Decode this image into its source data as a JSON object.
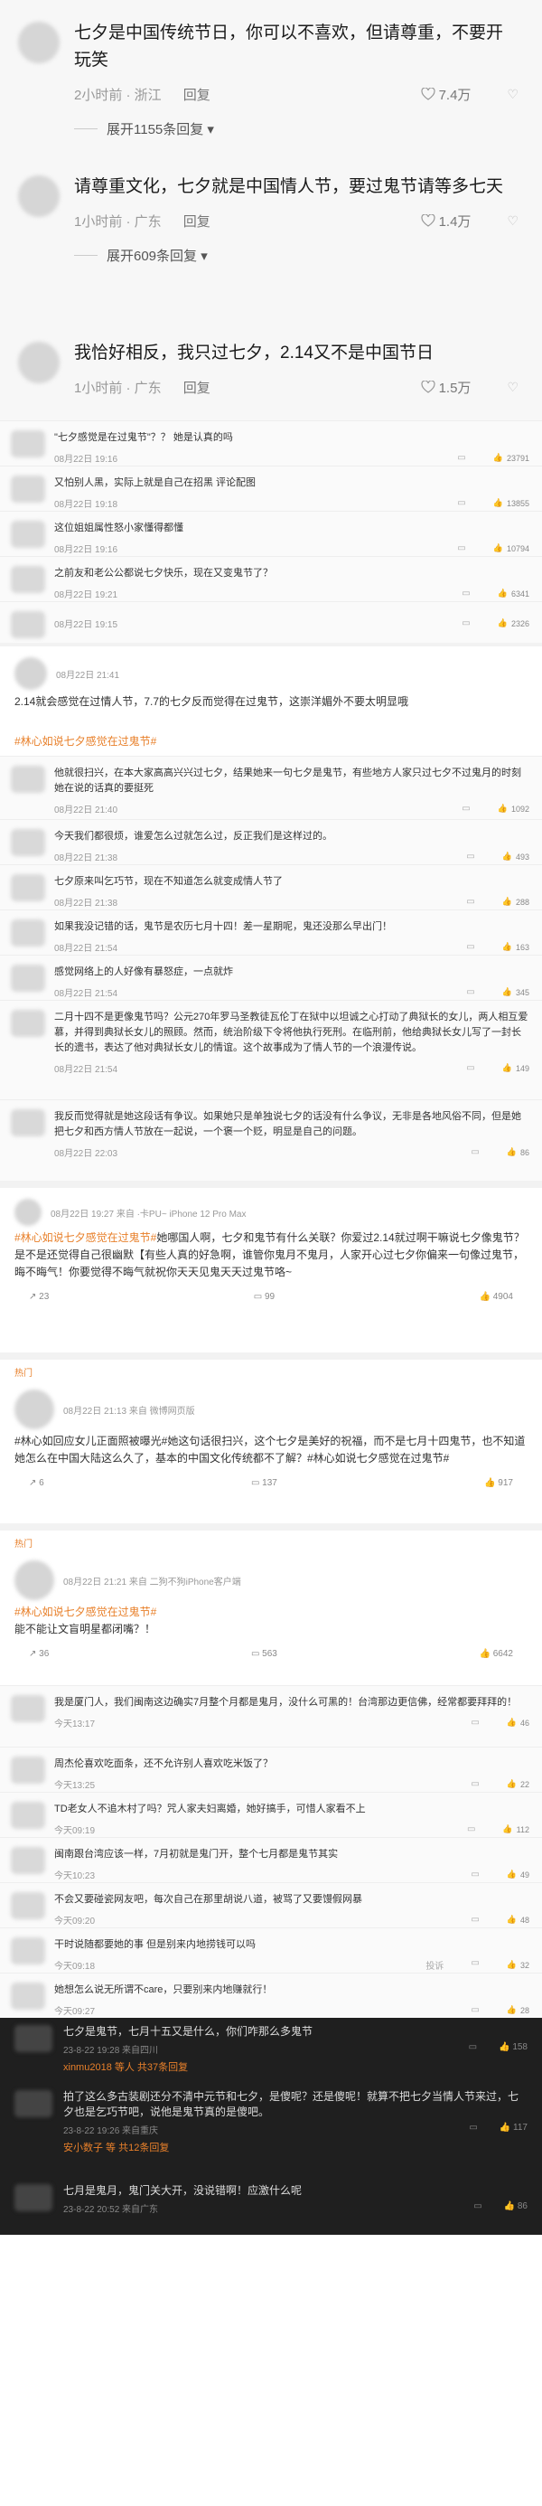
{
  "top_comments": [
    {
      "text": "七夕是中国传统节日，你可以不喜欢，但请尊重，不要开玩笑",
      "time": "2小时前 · 浙江",
      "reply": "回复",
      "likes": "7.4万",
      "expand": "展开1155条回复"
    },
    {
      "text": "请尊重文化，七夕就是中国情人节，要过鬼节请等多七天",
      "time": "1小时前 · 广东",
      "reply": "回复",
      "likes": "1.4万",
      "expand": "展开609条回复"
    },
    {
      "text": "我恰好相反，我只过七夕，2.14又不是中国节日",
      "time": "1小时前 · 广东",
      "reply": "回复",
      "likes": "1.5万",
      "expand": ""
    }
  ],
  "small_comments": [
    {
      "text": "\"七夕感觉是在过鬼节\"？？ 她是认真的吗",
      "date": "08月22日 19:16",
      "likes": "23791"
    },
    {
      "text": "又怕别人黑，实际上就是自己在招黑 评论配图",
      "date": "08月22日 19:18",
      "likes": "13855"
    },
    {
      "text": "这位姐姐属性怒小家懂得都懂",
      "date": "08月22日 19:16",
      "likes": "10794"
    },
    {
      "text": "之前友和老公公都说七夕快乐，现在又变鬼节了？",
      "date": "08月22日 19:21",
      "likes": "6341"
    },
    {
      "text": "",
      "date": "08月22日 19:15",
      "likes": "2326"
    }
  ],
  "post1": {
    "date": "08月22日 21:41",
    "text": "2.14就会感觉在过情人节，7.7的七夕反而觉得在过鬼节，这崇洋媚外不要太明显哦",
    "topic": "#林心如说七夕感觉在过鬼节#"
  },
  "replies": [
    {
      "text": "他就很扫兴，在本大家高高兴兴过七夕，结果她来一句七夕是鬼节，有些地方人家只过七夕不过鬼月的时刻她在说的话真的要挺死",
      "date": "08月22日 21:40",
      "likes": "1092"
    },
    {
      "text": "今天我们都很烦，谁爱怎么过就怎么过，反正我们是这样过的。",
      "date": "08月22日 21:38",
      "likes": "493"
    },
    {
      "text": "七夕原来叫乞巧节，现在不知道怎么就变成情人节了",
      "date": "08月22日 21:38",
      "likes": "288"
    },
    {
      "text": "如果我没记错的话，鬼节是农历七月十四！差一星期呢，鬼还没那么早出门！",
      "date": "08月22日 21:54",
      "likes": "163"
    },
    {
      "text": "感觉网络上的人好像有暴怒症，一点就炸",
      "date": "08月22日 21:54",
      "likes": "345"
    },
    {
      "text": "二月十四不是更像鬼节吗？公元270年罗马圣教徒瓦伦丁在狱中以坦诚之心打动了典狱长的女儿，两人相互爱慕，并得到典狱长女儿的照顾。然而，统治阶级下令将他执行死刑。在临刑前，他给典狱长女儿写了一封长长的遗书，表达了他对典狱长女儿的情谊。这个故事成为了情人节的一个浪漫传说。",
      "date": "08月22日 21:54",
      "likes": "149"
    },
    {
      "text": "我反而觉得就是她这段话有争议。如果她只是单独说七夕的话没有什么争议，无非是各地风俗不同，但是她把七夕和西方情人节放在一起说，一个褒一个贬，明显是自己的问题。",
      "date": "08月22日 22:03",
      "likes": "86"
    }
  ],
  "post2": {
    "date": "08月22日 19:27  来自 ·卡PU~ iPhone 12 Pro Max",
    "topic": "#林心如说七夕感觉在过鬼节#",
    "text": "她哪国人啊，七夕和鬼节有什么关联？你爱过2.14就过啊干嘛说七夕像鬼节？是不是还觉得自己很幽默【有些人真的好急啊，谁管你鬼月不鬼月，人家开心过七夕你偏来一句像过鬼节，晦不晦气！你要觉得不晦气就祝你天天见鬼天天过鬼节咯~",
    "repost": "23",
    "comments": "99",
    "likes": "4904"
  },
  "hot_label": "热门",
  "post3": {
    "date": "08月22日 21:13  来自 微博网页版",
    "text": "#林心如回应女儿正面照被曝光#她这句话很扫兴，这个七夕是美好的祝福，而不是七月十四鬼节，也不知道她怎么在中国大陆这么久了，基本的中国文化传统都不了解？#林心如说七夕感觉在过鬼节#",
    "repost": "6",
    "comments": "137",
    "likes": "917"
  },
  "post4": {
    "date": "08月22日 21:21  来自 二狗不狗iPhone客户端",
    "topic": "#林心如说七夕感觉在过鬼节#",
    "text": "能不能让文盲明星都闭嘴？！",
    "repost": "36",
    "comments": "563",
    "likes": "6642"
  },
  "replies2": [
    {
      "text": "我是厦门人，我们闽南这边确实7月整个月都是鬼月，没什么可黑的！台湾那边更信佛，经常都要拜拜的！",
      "date": "今天13:17",
      "likes": "46"
    },
    {
      "text": "周杰伦喜欢吃面条，还不允许别人喜欢吃米饭了？",
      "date": "今天13:25",
      "likes": "22"
    },
    {
      "text": "TD老女人不追木村了吗？咒人家夫妇离婚，她好搞手，可惜人家看不上",
      "date": "今天09:19",
      "likes": "112"
    },
    {
      "text": "闽南跟台湾应该一样，7月初就是鬼门开，整个七月都是鬼节其实",
      "date": "今天10:23",
      "likes": "49"
    },
    {
      "text": "不会又要碰瓷网友吧，每次自己在那里胡说八道，被骂了又要馒假网暴",
      "date": "今天09:20",
      "likes": "48"
    },
    {
      "text": "干时说随都要她的事 但是别来内地捞钱可以吗",
      "date": "今天09:18",
      "likes": "32",
      "extra": "投诉"
    },
    {
      "text": "她想怎么说无所谓不care，只要别来内地赚就行！",
      "date": "今天09:27",
      "likes": "28"
    }
  ],
  "dark_rows": [
    {
      "text": "七夕是鬼节，七月十五又是什么，你们咋那么多鬼节",
      "date": "23-8-22 19:28 来自四川",
      "likes": "158",
      "sub": "xinmu2018 等人  共37条回复"
    },
    {
      "text": "拍了这么多古装剧还分不清中元节和七夕，是傻呢？还是傻呢！就算不把七夕当情人节来过，七夕也是乞巧节吧，说他是鬼节真的是傻吧。",
      "date": "23-8-22 19:26 来自重庆",
      "likes": "117",
      "sub": "安小数子 等  共12条回复"
    },
    {
      "text": "七月是鬼月，鬼门关大开，没说错啊！应激什么呢",
      "date": "23-8-22 20:52 来自广东",
      "likes": "86",
      "sub": ""
    }
  ]
}
